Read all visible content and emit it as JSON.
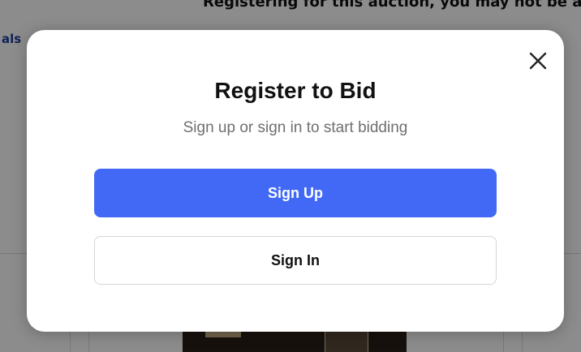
{
  "background": {
    "top_text": "Registering for this auction, you may not be able to bid",
    "side_link": "als"
  },
  "modal": {
    "title": "Register to Bid",
    "subtitle": "Sign up or sign in to start bidding",
    "close_icon": "close-icon",
    "sign_up_label": "Sign Up",
    "sign_in_label": "Sign In"
  },
  "colors": {
    "primary": "#4169f6",
    "overlay": "rgba(0,0,0,0.45)",
    "title": "#111111",
    "subtitle": "#6f6f6f"
  }
}
